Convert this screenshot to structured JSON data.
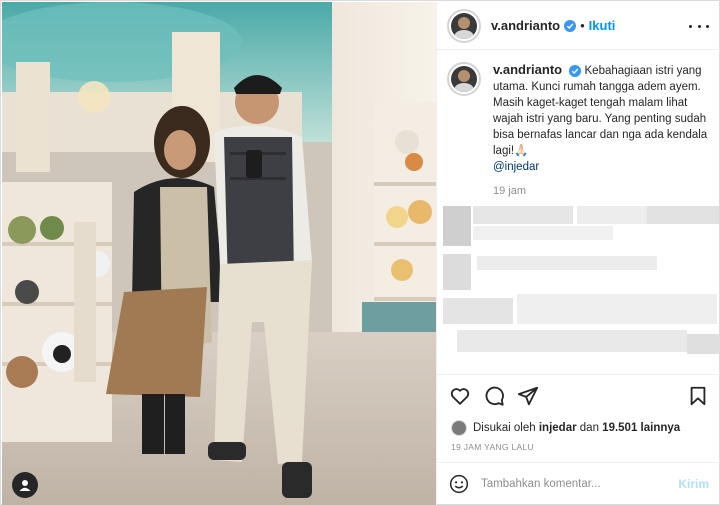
{
  "post": {
    "username": "v.andrianto",
    "follow_label": "Ikuti",
    "dot_sep": "•",
    "caption": "Kebahagiaan istri yang utama. Kunci rumah tangga adem ayem. Masih kaget-kaget tengah malam lihat wajah istri yang baru. Yang penting sudah bisa bernafas lancar dan nga ada kendala lagi!",
    "caption_emoji": "🙏🏻",
    "mention": "@injedar",
    "caption_time": "19 jam"
  },
  "likes": {
    "prefix": "Disukai oleh",
    "liker": "injedar",
    "middle": "dan",
    "count": "19.501 lainnya"
  },
  "timestamp": "19 JAM YANG LALU",
  "comment": {
    "placeholder": "Tambahkan komentar...",
    "post_label": "Kirim"
  },
  "icons": {
    "verified": "verified-badge-icon",
    "more": "more-options-icon",
    "like": "heart-icon",
    "comment": "comment-bubble-icon",
    "share": "paper-plane-icon",
    "save": "bookmark-icon",
    "emoji": "smiley-icon",
    "tagged_user": "user-icon"
  },
  "colors": {
    "accent": "#0095f6",
    "verified": "#3897f0",
    "muted": "#8e8e8e",
    "post_disabled": "#b2dffc"
  }
}
